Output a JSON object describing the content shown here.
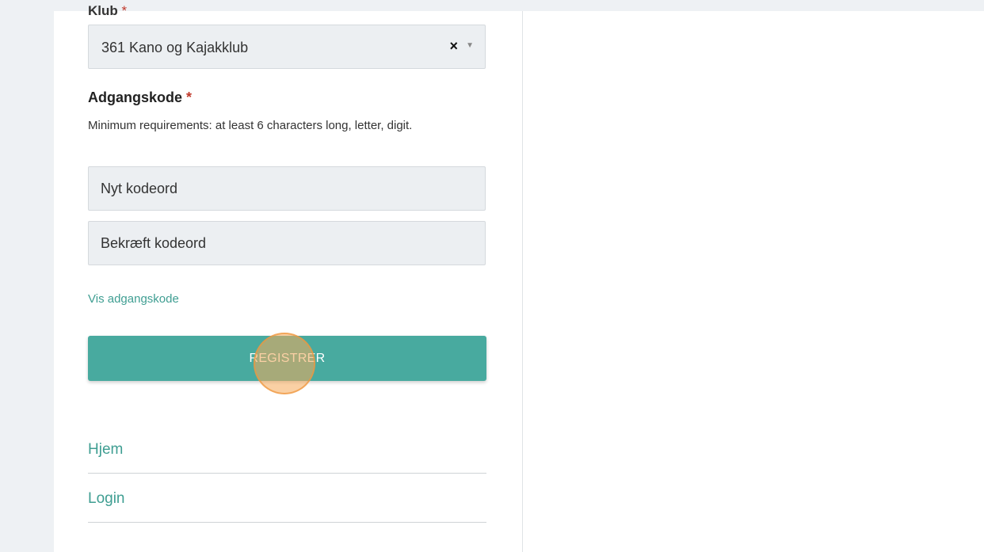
{
  "form": {
    "club": {
      "label": "Klub",
      "required_mark": "*",
      "selected_value": "361 Kano og Kajakklub",
      "clear_glyph": "×",
      "caret_glyph": "▼"
    },
    "password": {
      "label": "Adgangskode",
      "required_mark": "*",
      "help": "Minimum requirements: at least 6 characters long, letter, digit.",
      "new_placeholder": "Nyt kodeord",
      "confirm_placeholder": "Bekræft kodeord",
      "show_link": "Vis adgangskode"
    },
    "submit_label": "REGISTRER"
  },
  "nav": {
    "home": "Hjem",
    "login": "Login"
  },
  "colors": {
    "accent": "#48aa9f",
    "link": "#3f9e92",
    "required": "#c0392b"
  }
}
